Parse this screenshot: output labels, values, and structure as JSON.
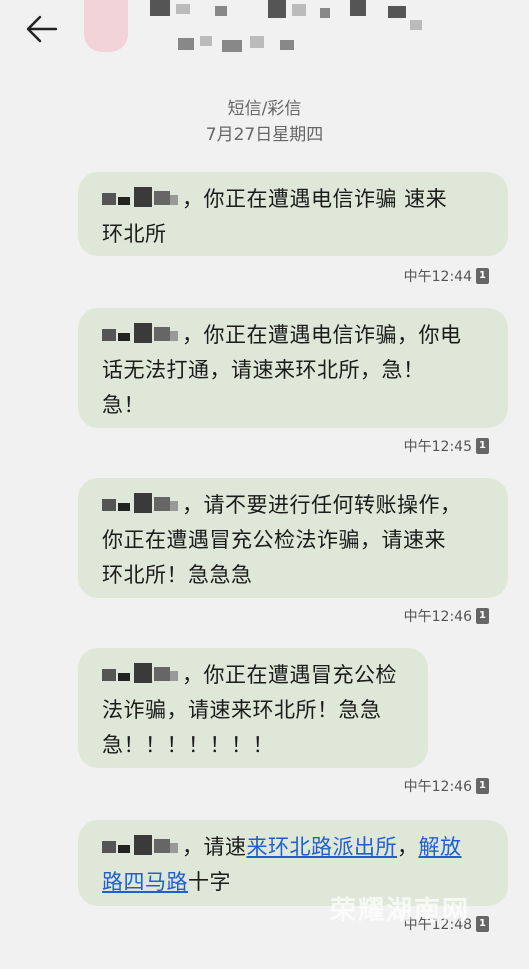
{
  "header": {
    "date_category": "短信/彩信",
    "date": "7月27日星期四"
  },
  "messages": [
    {
      "text_a": "，你正在遭遇电信诈骗 速来",
      "text_b": "环北所",
      "time": "中午12:44",
      "sim": "1"
    },
    {
      "text_a": "，你正在遭遇电信诈骗，你电",
      "text_b": "话无法打通，请速来环北所，急！",
      "text_c": "急！",
      "time": "中午12:45",
      "sim": "1"
    },
    {
      "text_a": "，请不要进行任何转账操作，",
      "text_b": "你正在遭遇冒充公检法诈骗，请速来",
      "text_c": "环北所！急急急",
      "time": "中午12:46",
      "sim": "1"
    },
    {
      "text_a": "，你正在遭遇冒充公检",
      "text_b": "法诈骗，请速来环北所！急急",
      "text_c": "急！！！！！！！",
      "time": "中午12:46",
      "sim": "1"
    },
    {
      "text_a": "，请速",
      "link1": "来环北路派出所",
      "sep": "，",
      "link2_a": "解放",
      "link2_b": "路四马路",
      "tail": "十字",
      "time": "中午12:48",
      "sim": "1"
    }
  ],
  "watermark": "荣耀湖南网",
  "icons": {
    "back": "back-arrow-icon",
    "sim": "sim-card-icon"
  }
}
